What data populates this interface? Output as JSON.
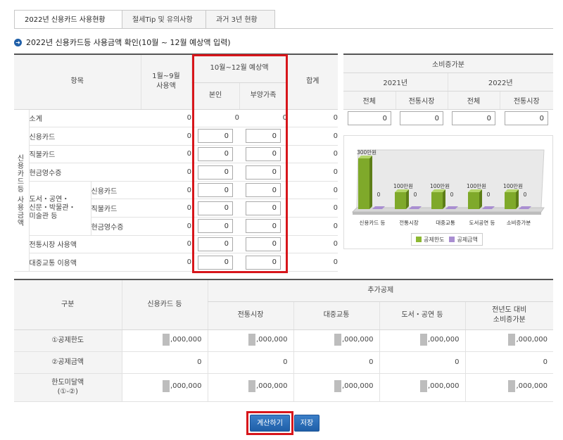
{
  "tabs": [
    {
      "label": "2022년 신용카드 사용현황"
    },
    {
      "label": "절세Tip 및 유의사항"
    },
    {
      "label": "과거 3년 현황"
    }
  ],
  "section_title": "2022년 신용카드등 사용금액 확인(10월 ~ 12월 예상액 입력)",
  "main_table": {
    "headers": {
      "item": "항목",
      "jan_sep": "1월~9월\n사용액",
      "oct_dec": "10월~12월 예상액",
      "self": "본인",
      "dependents": "부양가족",
      "total": "합계"
    },
    "group_label": "신용카드등 사용금액",
    "culture_label": "도서・공연・\n신문・박물관・\n미술관 등",
    "rows": [
      {
        "label": "소계",
        "jan_sep": "0",
        "self": "0",
        "dependents": "0",
        "total": "0"
      },
      {
        "label": "신용카드",
        "jan_sep": "0",
        "self": "0",
        "dependents": "0",
        "total": "0"
      },
      {
        "label": "직불카드",
        "jan_sep": "0",
        "self": "0",
        "dependents": "0",
        "total": "0"
      },
      {
        "label": "현금영수증",
        "jan_sep": "0",
        "self": "0",
        "dependents": "0",
        "total": "0"
      },
      {
        "label": "신용카드",
        "jan_sep": "0",
        "self": "0",
        "dependents": "0",
        "total": "0"
      },
      {
        "label": "직불카드",
        "jan_sep": "0",
        "self": "0",
        "dependents": "0",
        "total": "0"
      },
      {
        "label": "현금영수증",
        "jan_sep": "0",
        "self": "0",
        "dependents": "0",
        "total": "0"
      },
      {
        "label": "전통시장 사용액",
        "jan_sep": "0",
        "self": "0",
        "dependents": "0",
        "total": "0"
      },
      {
        "label": "대중교통 이용액",
        "jan_sep": "0",
        "self": "0",
        "dependents": "0",
        "total": "0"
      }
    ]
  },
  "consumption_increase": {
    "title": "소비증가분",
    "years": [
      "2021년",
      "2022년"
    ],
    "cols": [
      "전체",
      "전통시장",
      "전체",
      "전통시장"
    ],
    "values": [
      "0",
      "0",
      "0",
      "0"
    ]
  },
  "chart_data": {
    "type": "bar",
    "categories": [
      "신용카드 등",
      "전통시장",
      "대중교통",
      "도서공연 등",
      "소비증가분"
    ],
    "series": [
      {
        "name": "공제한도",
        "values": [
          300,
          100,
          100,
          100,
          100
        ],
        "labels": [
          "300만원",
          "100만원",
          "100만원",
          "100만원",
          "100만원"
        ],
        "color": "#8cb832"
      },
      {
        "name": "공제금액",
        "values": [
          0,
          0,
          0,
          0,
          0
        ],
        "labels": [
          "0",
          "0",
          "0",
          "0",
          "0"
        ],
        "color": "#a98ed1"
      }
    ],
    "ylim": [
      0,
      300
    ]
  },
  "bottom_table": {
    "headers": {
      "category": "구분",
      "credit": "신용카드 등",
      "additional": "추가공제",
      "market": "전통시장",
      "transit": "대중교통",
      "culture": "도서・공연 등",
      "increase": "전년도 대비\n소비증가분"
    },
    "rows": [
      {
        "label": "①공제한도",
        "values": [
          ",000,000",
          ",000,000",
          ",000,000",
          ",000,000",
          ",000,000"
        ],
        "masked": true
      },
      {
        "label": "②공제금액",
        "values": [
          "0",
          "0",
          "0",
          "0",
          "0"
        ],
        "masked": false
      },
      {
        "label": "한도미달액\n(①-②)",
        "values": [
          ",000,000",
          ",000,000",
          ",000,000",
          ",000,000",
          ",000,000"
        ],
        "masked": true
      }
    ]
  },
  "buttons": {
    "calculate": "계산하기",
    "save": "저장"
  },
  "colors": {
    "accent": "#1f5fa8",
    "highlight": "#d7161b"
  }
}
